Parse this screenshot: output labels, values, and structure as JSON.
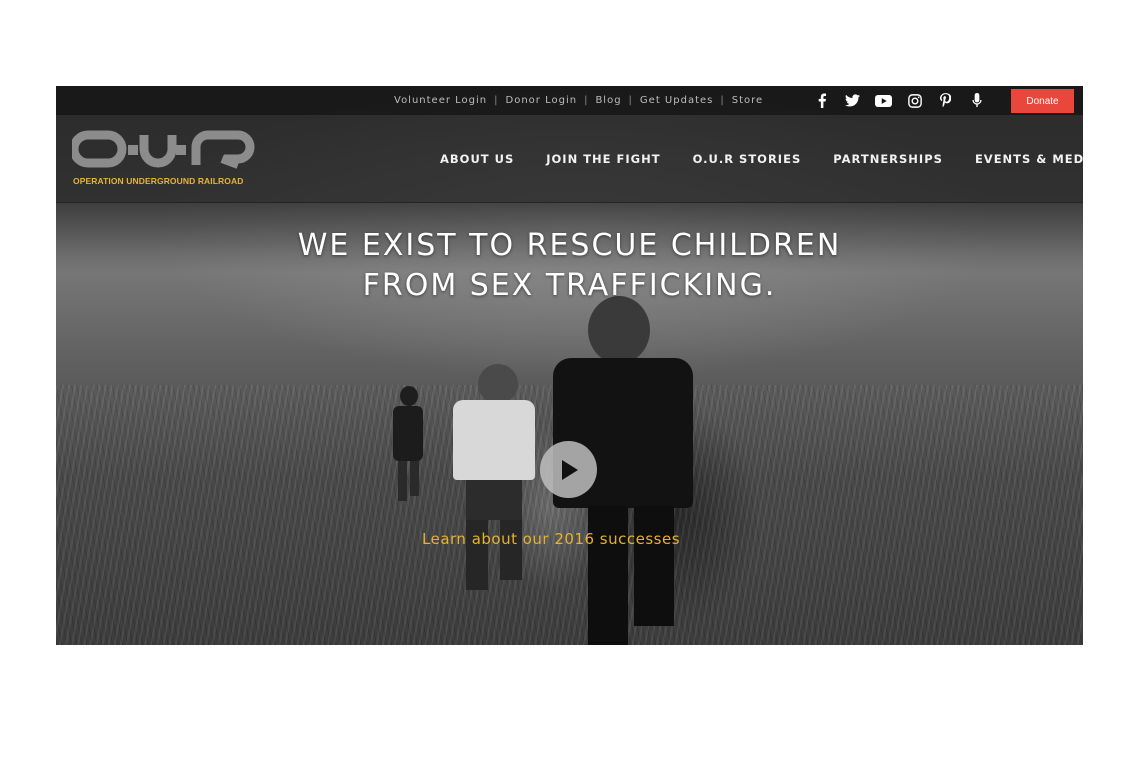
{
  "topbar": {
    "links": [
      "Volunteer Login",
      "Donor Login",
      "Blog",
      "Get Updates",
      "Store"
    ],
    "separator": "|",
    "social_icons": [
      "facebook-icon",
      "twitter-icon",
      "youtube-icon",
      "instagram-icon",
      "pinterest-icon",
      "microphone-icon"
    ],
    "donate_label": "Donate"
  },
  "header": {
    "logo_text": "O.U.R",
    "logo_tagline": "OPERATION UNDERGROUND RAILROAD",
    "nav": [
      "ABOUT US",
      "JOIN THE FIGHT",
      "O.U.R STORIES",
      "PARTNERSHIPS",
      "EVENTS & MEDIA"
    ]
  },
  "hero": {
    "headline_line1": "WE EXIST TO RESCUE CHILDREN",
    "headline_line2": "FROM SEX TRAFFICKING.",
    "cta": "Learn about our 2016 successes"
  },
  "colors": {
    "accent": "#e6b22c",
    "donate": "#e9463c",
    "topbar": "#141414"
  }
}
